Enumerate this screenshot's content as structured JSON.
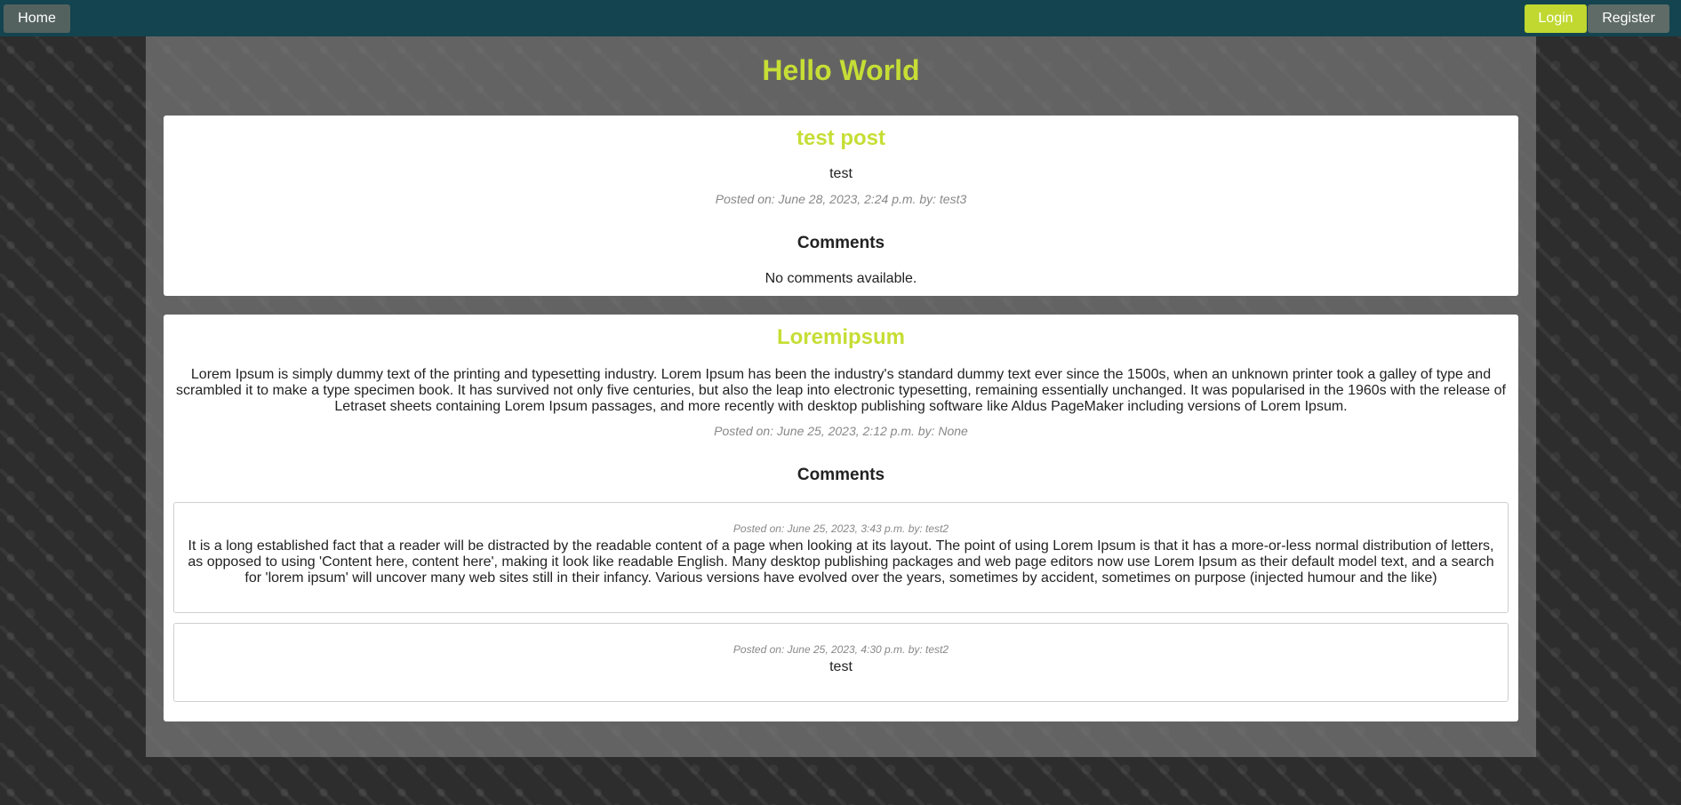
{
  "nav": {
    "home_label": "Home",
    "login_label": "Login",
    "register_label": "Register"
  },
  "site": {
    "title": "Hello World"
  },
  "colors": {
    "accent": "#c6de35",
    "navbar": "#13444f"
  },
  "posts": [
    {
      "title": "test post",
      "body": "test",
      "meta": "Posted on: June 28, 2023, 2:24 p.m. by: test3",
      "comments_heading": "Comments",
      "no_comments": "No comments available."
    },
    {
      "title": "Loremipsum",
      "body": "Lorem Ipsum is simply dummy text of the printing and typesetting industry. Lorem Ipsum has been the industry's standard dummy text ever since the 1500s, when an unknown printer took a galley of type and scrambled it to make a type specimen book. It has survived not only five centuries, but also the leap into electronic typesetting, remaining essentially unchanged. It was popularised in the 1960s with the release of Letraset sheets containing Lorem Ipsum passages, and more recently with desktop publishing software like Aldus PageMaker including versions of Lorem Ipsum.",
      "meta": "Posted on: June 25, 2023, 2:12 p.m. by: None",
      "comments_heading": "Comments",
      "comments": [
        {
          "meta": "Posted on: June 25, 2023, 3:43 p.m. by: test2",
          "body": "It is a long established fact that a reader will be distracted by the readable content of a page when looking at its layout. The point of using Lorem Ipsum is that it has a more-or-less normal distribution of letters, as opposed to using 'Content here, content here', making it look like readable English. Many desktop publishing packages and web page editors now use Lorem Ipsum as their default model text, and a search for 'lorem ipsum' will uncover many web sites still in their infancy. Various versions have evolved over the years, sometimes by accident, sometimes on purpose (injected humour and the like)"
        },
        {
          "meta": "Posted on: June 25, 2023, 4:30 p.m. by: test2",
          "body": "test"
        }
      ]
    }
  ]
}
